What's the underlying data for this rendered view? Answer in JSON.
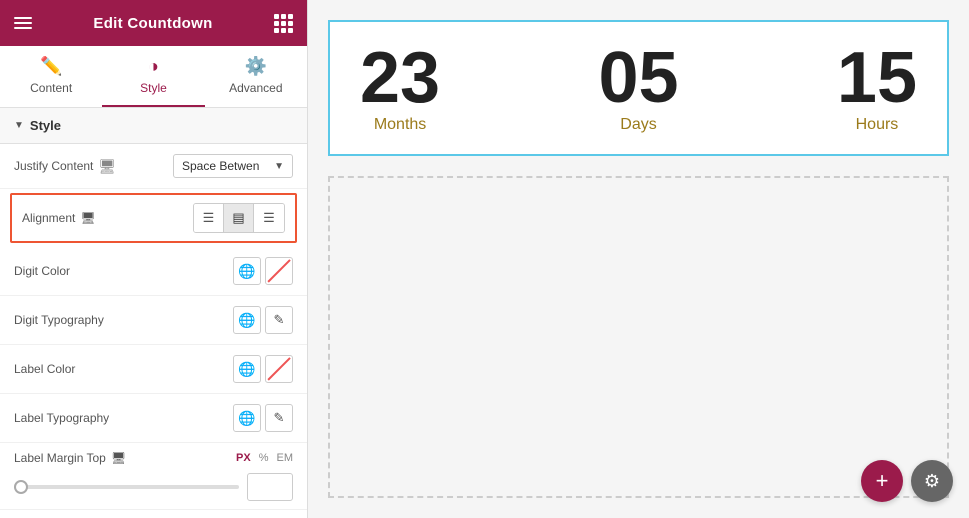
{
  "header": {
    "title": "Edit Countdown",
    "hamburger_label": "menu",
    "grid_label": "apps"
  },
  "tabs": [
    {
      "id": "content",
      "label": "Content",
      "icon": "✏️",
      "active": false
    },
    {
      "id": "style",
      "label": "Style",
      "icon": "◑",
      "active": true
    },
    {
      "id": "advanced",
      "label": "Advanced",
      "icon": "⚙️",
      "active": false
    }
  ],
  "section": {
    "label": "Style",
    "arrow": "▼"
  },
  "fields": {
    "justify_content": {
      "label": "Justify Content",
      "responsive_icon": "🖥",
      "dropdown_value": "Space Betwen",
      "dropdown_arrow": "▼"
    },
    "alignment": {
      "label": "Alignment",
      "responsive_icon": "🖥",
      "options": [
        "left",
        "center",
        "right"
      ],
      "active": "center"
    },
    "digit_color": {
      "label": "Digit Color"
    },
    "digit_typography": {
      "label": "Digit Typography"
    },
    "label_color": {
      "label": "Label Color"
    },
    "label_typography": {
      "label": "Label Typography"
    },
    "label_margin_top": {
      "label": "Label Margin Top",
      "responsive_icon": "🖥",
      "units": [
        "PX",
        "%",
        "EM"
      ],
      "active_unit": "PX",
      "value": "",
      "slider_value": 0
    }
  },
  "countdown": {
    "months": {
      "value": "23",
      "label": "Months"
    },
    "days": {
      "value": "05",
      "label": "Days"
    },
    "hours": {
      "value": "15",
      "label": "Hours"
    }
  },
  "buttons": {
    "add": "+",
    "settings": "⚙"
  },
  "colors": {
    "brand": "#9b1b4b",
    "highlight_border": "#e53333",
    "cyan_border": "#5bc8e8"
  }
}
